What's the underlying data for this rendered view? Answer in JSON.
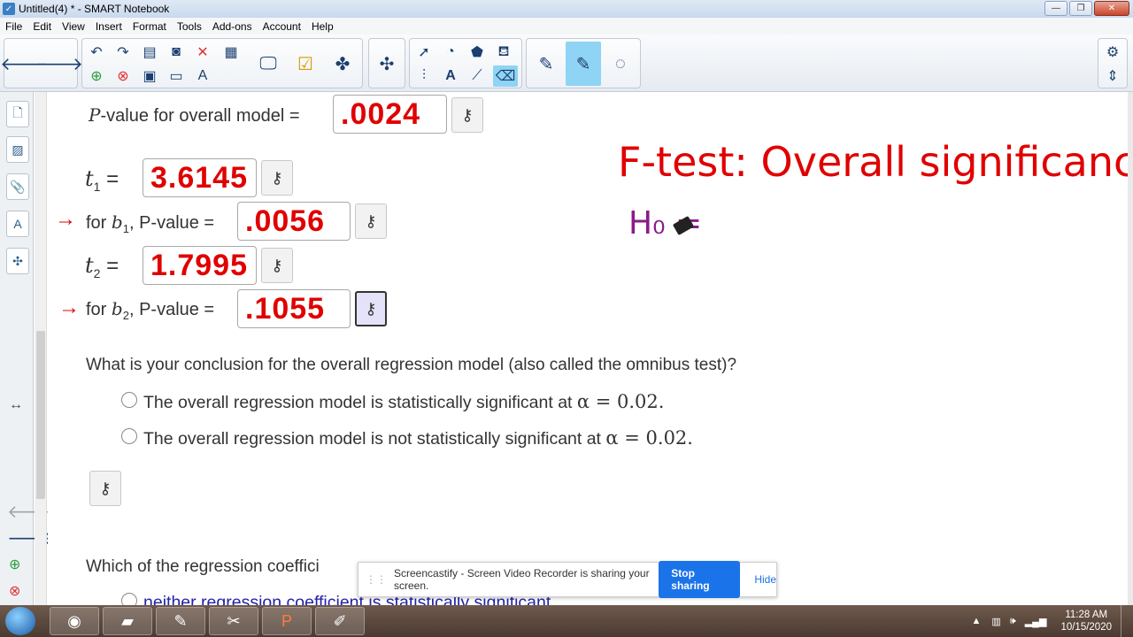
{
  "window": {
    "title": "Untitled(4) * - SMART Notebook"
  },
  "menu": [
    "File",
    "Edit",
    "View",
    "Insert",
    "Format",
    "Tools",
    "Add-ons",
    "Account",
    "Help"
  ],
  "content": {
    "pvalue_overall_label": "-value for overall model =",
    "pvalue_overall_P": "P",
    "pvalue_overall_answer": ".0024",
    "t1_label": "t",
    "t1_sub": "1",
    "t1_eq": "=",
    "t1_answer": "3.6145",
    "b1_label_prefix": "for",
    "b1_var": "b",
    "b1_sub": "1",
    "b1_label_suffix": ", P-value =",
    "b1_answer": ".0056",
    "t2_label": "t",
    "t2_sub": "2",
    "t2_eq": "=",
    "t2_answer": "1.7995",
    "b2_label_prefix": "for",
    "b2_var": "b",
    "b2_sub": "2",
    "b2_label_suffix": ", P-value =",
    "b2_answer": ".1055",
    "question1": "What is your conclusion for the overall regression model (also called the omnibus test)?",
    "option1_text": "The overall regression model is statistically significant at ",
    "option1_math": "α = 0.02.",
    "option2_text": "The overall regression model is not statistically significant at ",
    "option2_math": "α = 0.02.",
    "question2": "Which of the regression coeffici",
    "option3_partial": "neither regression coefficient is statistically significant"
  },
  "handwriting": {
    "title": "F-test: Overall significance",
    "h0": "H₀ ="
  },
  "share_bar": {
    "message": "Screencastify - Screen Video Recorder is sharing your screen.",
    "stop_label": "Stop sharing",
    "hide_label": "Hide"
  },
  "taskbar": {
    "time": "11:28 AM",
    "date": "10/15/2020"
  },
  "colors": {
    "answer_red": "#e00000",
    "handwriting_purple": "#8b1a8b",
    "share_blue": "#1a73e8"
  }
}
